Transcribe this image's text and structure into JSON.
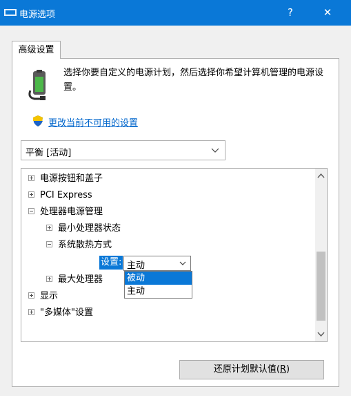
{
  "window": {
    "title": "电源选项",
    "help_label": "?",
    "close_label": "✕"
  },
  "tabs": [
    {
      "label": "高级设置"
    }
  ],
  "panel": {
    "description": "选择你要自定义的电源计划，然后选择你希望计算机管理的电源设置。",
    "change_link": "更改当前不可用的设置",
    "plan_select": {
      "value": "平衡 [活动]"
    }
  },
  "tree": {
    "items": [
      {
        "label": "电源按钮和盖子",
        "expander": "plus"
      },
      {
        "label": "PCI Express",
        "expander": "plus"
      },
      {
        "label": "处理器电源管理",
        "expander": "minus"
      },
      {
        "label": "最小处理器状态",
        "expander": "plus"
      },
      {
        "label": "系统散热方式",
        "expander": "minus"
      },
      {
        "label": "最大处理器",
        "expander": "plus"
      },
      {
        "label": "显示",
        "expander": "plus"
      },
      {
        "label": "\"多媒体\"设置",
        "expander": "plus"
      }
    ],
    "setting_label": "设置:",
    "setting_select_value": "主动",
    "dropdown_options": [
      {
        "label": "被动",
        "selected": true
      },
      {
        "label": "主动",
        "selected": false
      }
    ]
  },
  "buttons": {
    "restore_label": "还原计划默认值(",
    "restore_mnemonic": "R",
    "restore_suffix": ")"
  },
  "colors": {
    "accent": "#0a78d7",
    "link": "#0066cc"
  }
}
